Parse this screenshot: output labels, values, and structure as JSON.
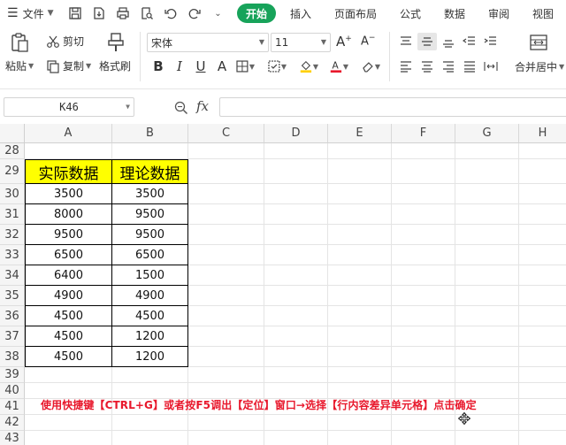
{
  "menubar": {
    "file_label": "文件",
    "tabs": [
      "开始",
      "插入",
      "页面布局",
      "公式",
      "数据",
      "审阅",
      "视图"
    ],
    "active_tab": "开始"
  },
  "ribbon": {
    "paste": "粘贴",
    "cut": "剪切",
    "copy": "复制",
    "format_painter": "格式刷",
    "font_name": "宋体",
    "font_size": "11",
    "merge_center": "合并居中"
  },
  "formula_bar": {
    "name_box": "K46",
    "fx": "fx",
    "formula": ""
  },
  "sheet": {
    "columns": [
      "A",
      "B",
      "C",
      "D",
      "E",
      "F",
      "G",
      "H"
    ],
    "rows": [
      "28",
      "29",
      "30",
      "31",
      "32",
      "33",
      "34",
      "35",
      "36",
      "37",
      "38",
      "39",
      "40",
      "41",
      "42",
      "43"
    ],
    "table_headers": [
      "实际数据",
      "理论数据"
    ],
    "table_rows": [
      [
        "3500",
        "3500"
      ],
      [
        "8000",
        "9500"
      ],
      [
        "9500",
        "9500"
      ],
      [
        "6500",
        "6500"
      ],
      [
        "6400",
        "1500"
      ],
      [
        "4900",
        "4900"
      ],
      [
        "4500",
        "4500"
      ],
      [
        "4500",
        "1200"
      ],
      [
        "4500",
        "1200"
      ]
    ],
    "note": "使用快捷键【CTRL+G】或者按F5调出【定位】窗口→选择【行内容差异单元格】点击确定"
  },
  "colors": {
    "accent": "#17a35a",
    "header_fill": "#ffff00",
    "note_text": "#e8182c"
  }
}
